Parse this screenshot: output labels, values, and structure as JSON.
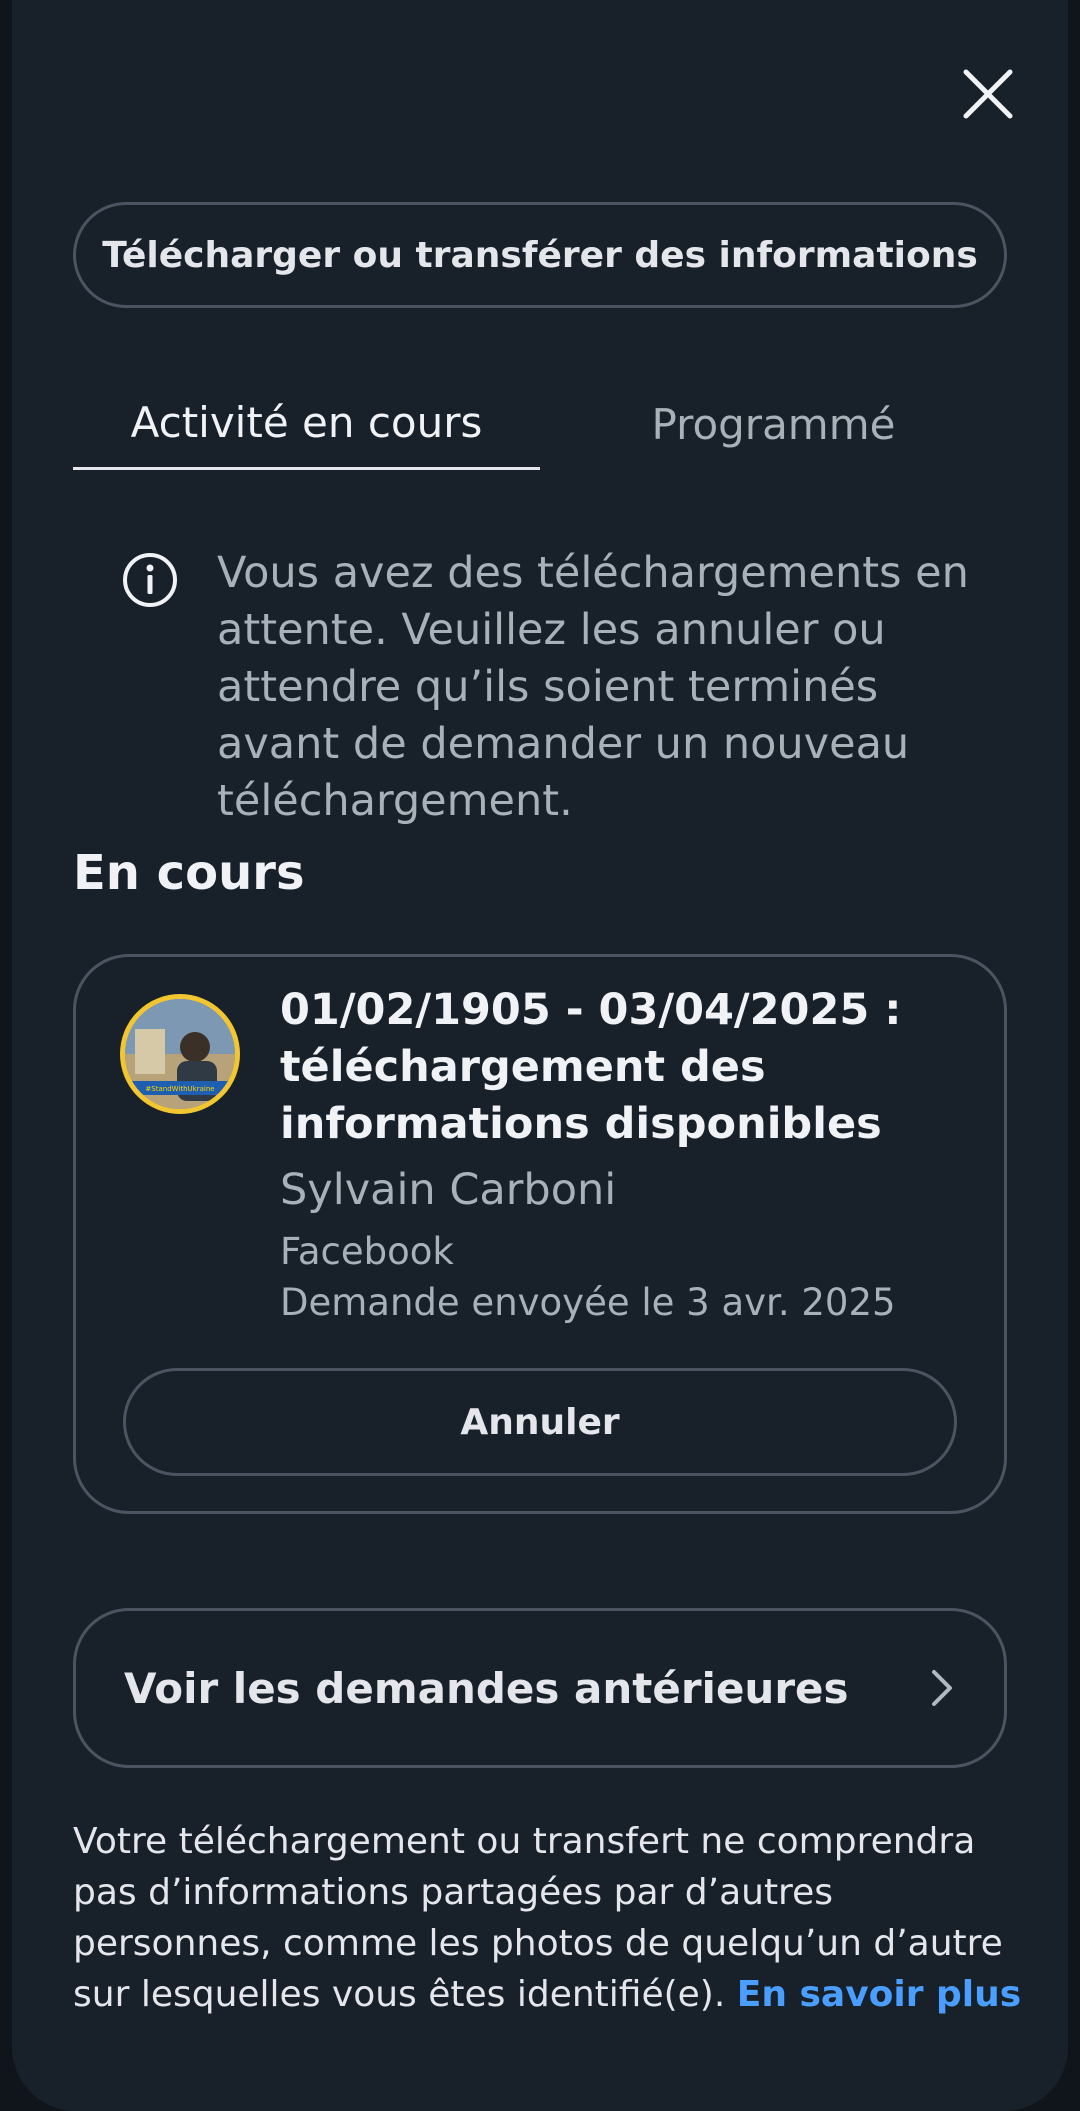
{
  "header": {
    "close_icon": "close-icon",
    "download_transfer_label": "Télécharger ou transférer des informations"
  },
  "tabs": [
    {
      "label": "Activité en cours",
      "active": true
    },
    {
      "label": "Programmé",
      "active": false
    }
  ],
  "notice": {
    "icon": "info-icon",
    "text": "Vous avez des téléchargements en attente. Veuillez les annuler ou attendre qu’ils soient terminés avant de demander un nouveau téléchargement."
  },
  "in_progress": {
    "section_title": "En cours",
    "request": {
      "avatar_badge_text": "#StandWithUkraine",
      "title": "01/02/1905 - 03/04/2025 : téléchargement des informations disponibles",
      "name": "Sylvain Carboni",
      "app": "Facebook",
      "date": "Demande envoyée le 3 avr. 2025",
      "cancel_label": "Annuler"
    }
  },
  "past_requests": {
    "label": "Voir les demandes antérieures",
    "icon": "chevron-right-icon"
  },
  "footer": {
    "text": "Votre téléchargement ou transfert ne comprendra pas d’informations partagées par d’autres personnes, comme les photos de quelqu’un d’autre sur lesquelles vous êtes identifié(e). ",
    "link": "En savoir plus"
  },
  "colors": {
    "background": "#18212a",
    "border": "#4a5561",
    "link": "#4a9eff",
    "avatar_ring": "#f2c631"
  }
}
